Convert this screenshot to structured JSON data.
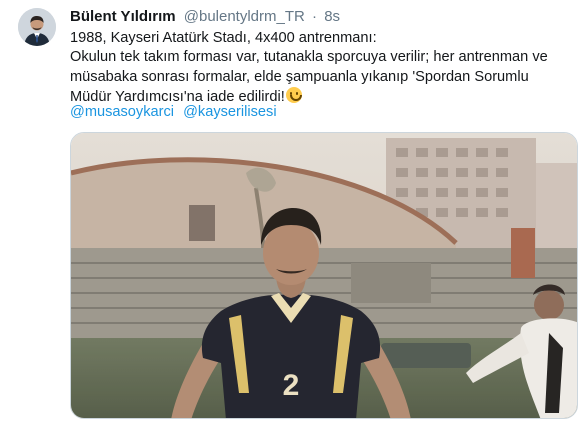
{
  "tweet": {
    "display_name": "Bülent Yıldırım",
    "handle": "@bulentyldrm_TR",
    "separator": "·",
    "time": "8s",
    "text_lines": [
      "1988, Kayseri Atatürk Stadı, 4x400 antrenmanı:",
      "Okulun tek takım forması var, tutanakla sporcuya verilir; her antrenman ve",
      "müsabaka sonrası formalar, elde şampuanla yıkanıp 'Spordan Sorumlu",
      "Müdür Yardımcısı'na iade edilirdi!"
    ],
    "emoji": "smiling-face-emoji",
    "mentions": [
      "@musasoykarci",
      "@kayserilisesi"
    ],
    "jersey_number": "2"
  },
  "colors": {
    "link": "#1b95e0",
    "secondary_text": "#657786",
    "primary_text": "#14171a"
  }
}
